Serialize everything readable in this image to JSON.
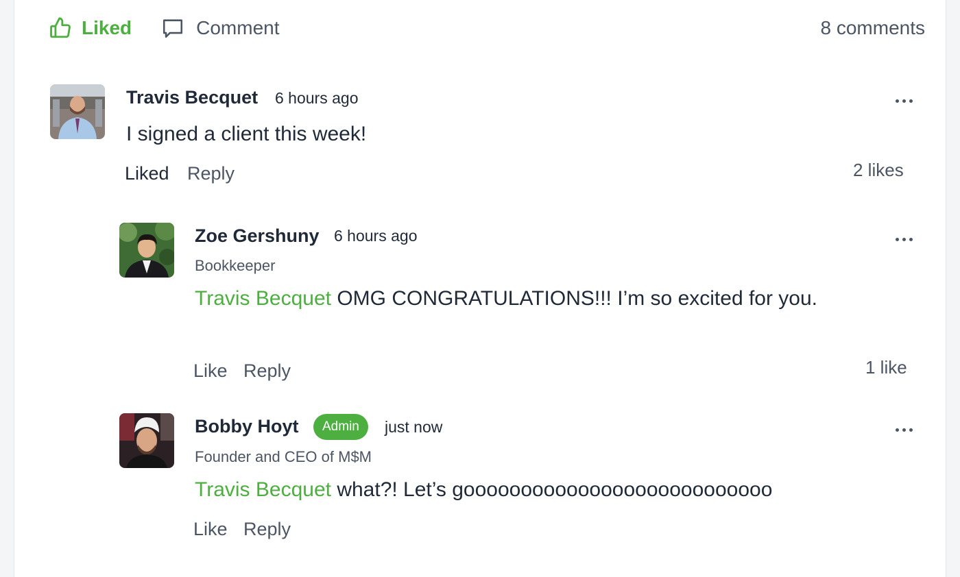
{
  "post_actions": {
    "liked_label": "Liked",
    "comment_label": "Comment",
    "comments_count": "8 comments",
    "accent_color": "#4caf3f"
  },
  "comments": [
    {
      "author": "Travis Becquet",
      "time": "6 hours ago",
      "text": "I signed a client this week!",
      "like_label": "Liked",
      "reply_label": "Reply",
      "likes": "2 likes",
      "more_icon": "ellipsis-icon"
    },
    {
      "author": "Zoe Gershuny",
      "time": "6 hours ago",
      "subtitle": "Bookkeeper",
      "mention": "Travis Becquet",
      "text": " OMG CONGRATULATIONS!!! I’m so excited for you.",
      "like_label": "Like",
      "reply_label": "Reply",
      "likes": "1 like",
      "more_icon": "ellipsis-icon"
    },
    {
      "author": "Bobby Hoyt",
      "badge": "Admin",
      "time": "just now",
      "subtitle": "Founder and CEO of M$M",
      "mention": "Travis Becquet",
      "text": " what?! Let’s gooooooooooooooooooooooooooo",
      "like_label": "Like",
      "reply_label": "Reply",
      "more_icon": "ellipsis-icon"
    }
  ]
}
